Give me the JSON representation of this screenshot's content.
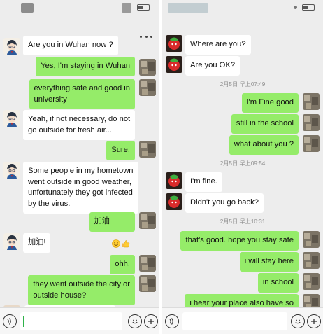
{
  "left_chat": {
    "messages": [
      {
        "side": "left",
        "avatar": "conan-avatar",
        "text": "Are you in Wuhan now ?"
      },
      {
        "side": "right",
        "avatar": "self-avatar",
        "text": "Yes, I'm staying in Wuhan"
      },
      {
        "side": "right",
        "avatar": "self-avatar",
        "text": "everything safe and good in\nuniversity"
      },
      {
        "side": "left",
        "avatar": "conan-avatar",
        "text": "Yeah, if not necessary, do not\ngo outside for fresh air..."
      },
      {
        "side": "right",
        "avatar": "self-avatar",
        "text": "Sure."
      },
      {
        "side": "left",
        "avatar": "conan-avatar",
        "text": "Some people in my hometown\nwent outside in good weather,\nunfortunately they got infected\nby the virus."
      },
      {
        "side": "right",
        "avatar": "self-avatar",
        "text": "加油",
        "emoji": [
          "smile-emoji",
          "thumbs-up-emoji"
        ]
      },
      {
        "side": "left",
        "avatar": "conan-avatar",
        "text": "加油!"
      },
      {
        "side": "right",
        "avatar": "self-avatar",
        "text": "ohh,"
      },
      {
        "side": "right",
        "avatar": "self-avatar",
        "text": "they went outside the city or\noutside house?"
      }
    ],
    "bottom_bar": {
      "voice_icon": "voice-icon",
      "emoji_icon": "emoji-icon",
      "add_icon": "add-icon",
      "input_value": ""
    }
  },
  "right_chat": {
    "messages": [
      {
        "side": "left",
        "avatar": "red-avatar",
        "text": "Where are you?"
      },
      {
        "side": "left",
        "avatar": "red-avatar",
        "text": "Are you OK?"
      },
      {
        "timestamp": "2月5日 早上07:49"
      },
      {
        "side": "right",
        "avatar": "self-avatar",
        "text": "I'm Fine good"
      },
      {
        "side": "right",
        "avatar": "self-avatar",
        "text": "still in the school"
      },
      {
        "side": "right",
        "avatar": "self-avatar",
        "text": "what about you ?"
      },
      {
        "timestamp": "2月5日 早上09:54"
      },
      {
        "side": "left",
        "avatar": "red-avatar",
        "text": "I'm fine."
      },
      {
        "side": "left",
        "avatar": "red-avatar",
        "text": "Didn't you go back?"
      },
      {
        "timestamp": "2月5日 早上10:31"
      },
      {
        "side": "right",
        "avatar": "self-avatar",
        "text": "that's good. hope you stay safe"
      },
      {
        "side": "right",
        "avatar": "self-avatar",
        "text": "i will stay here"
      },
      {
        "side": "right",
        "avatar": "self-avatar",
        "text": "in school"
      },
      {
        "side": "right",
        "avatar": "self-avatar",
        "text": "i hear your place also have so"
      }
    ],
    "bottom_bar": {
      "voice_icon": "voice-icon",
      "emoji_icon": "emoji-icon",
      "add_icon": "add-icon",
      "input_value": ""
    }
  },
  "colors": {
    "chat_background": "#ededed",
    "bubble_received": "#ffffff",
    "bubble_sent": "#95ec69",
    "timestamp_text": "#8f8f8f",
    "input_cursor": "#2fb24a"
  }
}
